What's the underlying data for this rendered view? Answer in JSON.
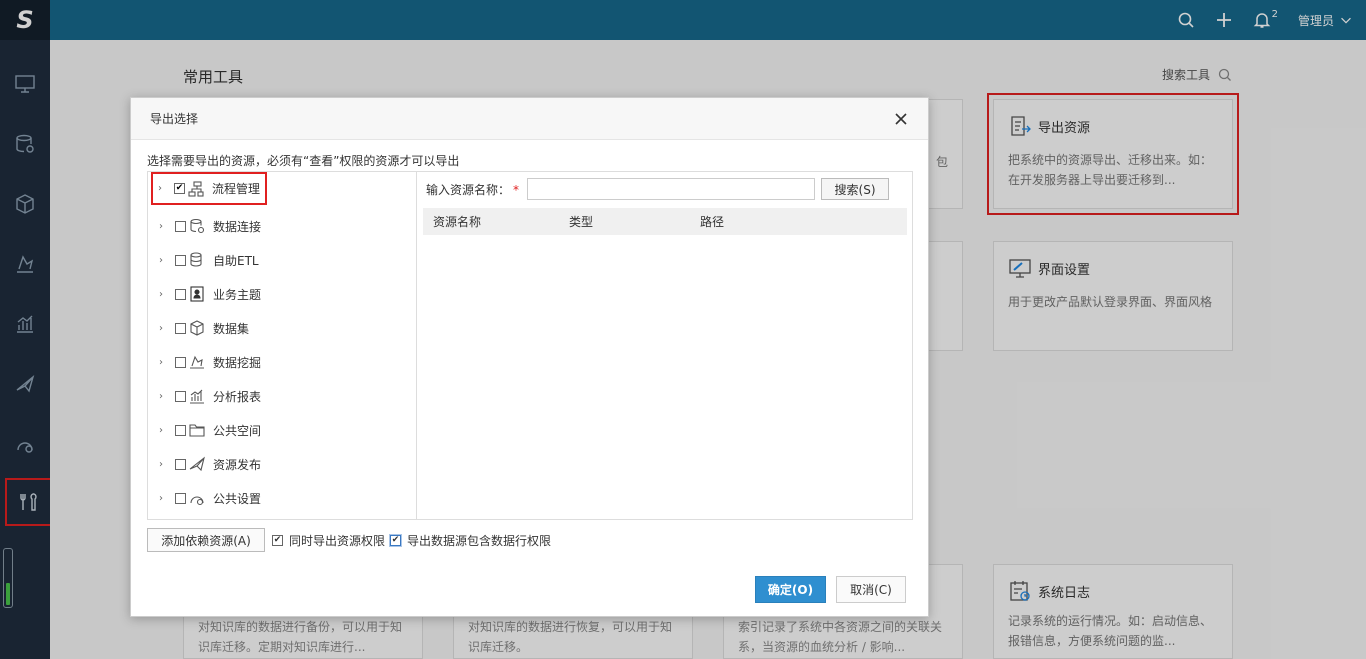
{
  "app": {
    "logo": "S"
  },
  "topbar": {
    "notif_count": "2",
    "user": "管理员"
  },
  "sidebar": {
    "items": [
      {
        "icon": "monitor-icon"
      },
      {
        "icon": "database-icon"
      },
      {
        "icon": "cube-icon"
      },
      {
        "icon": "mining-icon"
      },
      {
        "icon": "chart-icon"
      },
      {
        "icon": "send-icon"
      },
      {
        "icon": "public-settings-icon"
      },
      {
        "icon": "tools-icon",
        "active": true
      }
    ]
  },
  "main": {
    "section_title": "常用工具",
    "search_tool": "搜索工具",
    "cards": [
      {
        "title": "导出资源",
        "desc_line1": "把系统中的资源导出、迁移出来。如：",
        "desc_line2": "在开发服务器上导出要迁移到..."
      },
      {
        "title": "界面设置",
        "desc_line1": "用于更改产品默认登录界面、界面风格",
        "desc_line2": ""
      },
      {
        "title": "系统日志",
        "desc_line1": "记录系统的运行情况。如：启动信息、",
        "desc_line2": "报错信息，方便系统问题的监..."
      }
    ],
    "partial_card_text": "包",
    "bottom_cards": [
      {
        "line1": "对知识库的数据进行备份，可以用于知",
        "line2": "识库迁移。定期对知识库进行..."
      },
      {
        "line1": "对知识库的数据进行恢复，可以用于知",
        "line2": "识库迁移。"
      },
      {
        "line1": "索引记录了系统中各资源之间的关联关",
        "line2": "系，当资源的血统分析 / 影响..."
      }
    ]
  },
  "dialog": {
    "title": "导出选择",
    "hint": "选择需要导出的资源，必须有“查看”权限的资源才可以导出",
    "tree": [
      {
        "label": "流程管理",
        "checked": true,
        "icon": "flow-icon"
      },
      {
        "label": "数据连接",
        "checked": false,
        "icon": "data-connect-icon"
      },
      {
        "label": "自助ETL",
        "checked": false,
        "icon": "etl-icon"
      },
      {
        "label": "业务主题",
        "checked": false,
        "icon": "business-topic-icon"
      },
      {
        "label": "数据集",
        "checked": false,
        "icon": "dataset-icon"
      },
      {
        "label": "数据挖掘",
        "checked": false,
        "icon": "data-mining-icon"
      },
      {
        "label": "分析报表",
        "checked": false,
        "icon": "report-icon"
      },
      {
        "label": "公共空间",
        "checked": false,
        "icon": "folder-icon"
      },
      {
        "label": "资源发布",
        "checked": false,
        "icon": "publish-icon"
      },
      {
        "label": "公共设置",
        "checked": false,
        "icon": "settings-icon"
      }
    ],
    "search_label": "输入资源名称：",
    "search_required": "*",
    "search_value": "",
    "search_button": "搜索(S)",
    "columns": [
      "资源名称",
      "类型",
      "路径"
    ],
    "dependency_button": "添加依赖资源(A)",
    "option1": {
      "label": "同时导出资源权限",
      "checked": true
    },
    "option2": {
      "label": "导出数据源包含数据行权限",
      "checked": true
    },
    "ok": "确定(O)",
    "cancel": "取消(C)"
  }
}
